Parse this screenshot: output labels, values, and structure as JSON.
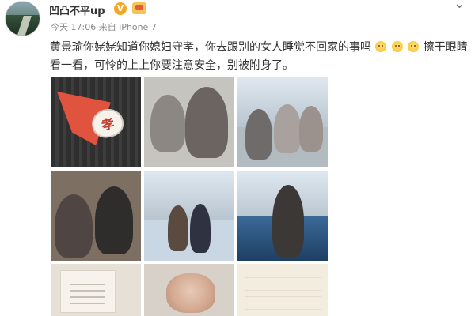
{
  "post": {
    "user_name": "凹凸不平up",
    "vip_badge": "V",
    "meta": "今天 17:06 来自 iPhone 7",
    "text_main": "黄景瑜你姥姥知道你媳妇守孝，你去跟别的女人睡觉不回家的事吗",
    "text_tail": "擦干眼睛看一看，可怜的上上你要注意安全，别被附身了。"
  },
  "icons": {
    "chevron": "chevron-down-icon",
    "avatar": "avatar",
    "crown": "member-crown-icon",
    "emoji": "face-emoji-icon"
  },
  "images": {
    "badge_text": "孝"
  },
  "colors": {
    "accent": "#e0533f",
    "vip": "#f5a623",
    "meta": "#888888"
  }
}
